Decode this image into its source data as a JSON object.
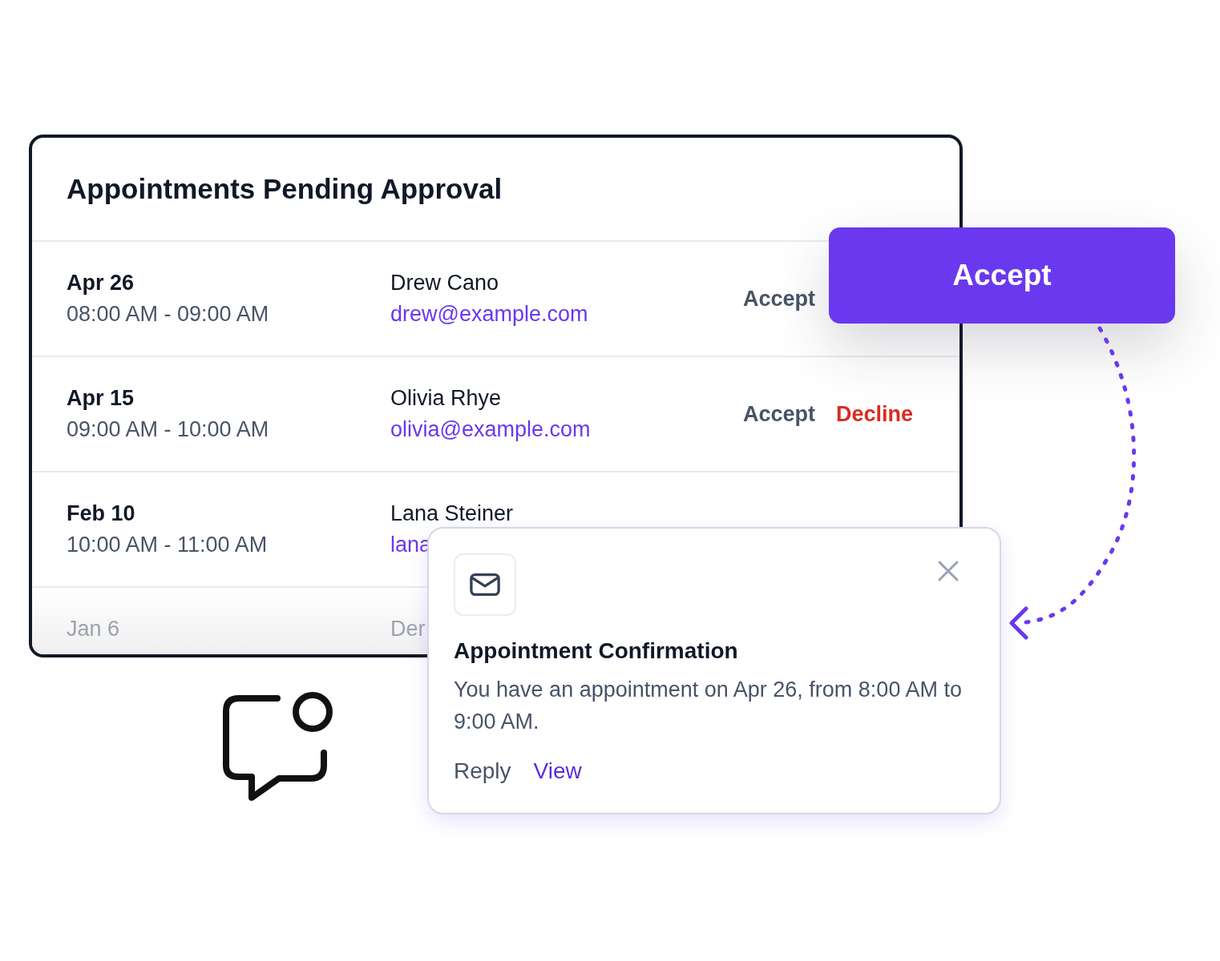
{
  "panel": {
    "title": "Appointments Pending Approval",
    "rows": [
      {
        "date": "Apr 26",
        "time": "08:00 AM - 09:00 AM",
        "name": "Drew Cano",
        "email": "drew@example.com",
        "actions": [
          {
            "kind": "accept",
            "label": "Accept"
          }
        ]
      },
      {
        "date": "Apr 15",
        "time": "09:00 AM - 10:00 AM",
        "name": "Olivia Rhye",
        "email": "olivia@example.com",
        "actions": [
          {
            "kind": "accept",
            "label": "Accept"
          },
          {
            "kind": "decline",
            "label": "Decline"
          }
        ]
      },
      {
        "date": "Feb 10",
        "time": "10:00 AM - 11:00 AM",
        "name": "Lana Steiner",
        "email": "lana",
        "actions": []
      },
      {
        "date": "Jan 6",
        "name": "Der",
        "actions": []
      }
    ]
  },
  "accept_button": {
    "label": "Accept"
  },
  "notification": {
    "title": "Appointment Confirmation",
    "message": "You have an appointment on Apr 26, from 8:00 AM to 9:00 AM.",
    "actions": [
      {
        "kind": "secondary",
        "label": "Reply"
      },
      {
        "kind": "primary",
        "label": "View"
      }
    ]
  }
}
